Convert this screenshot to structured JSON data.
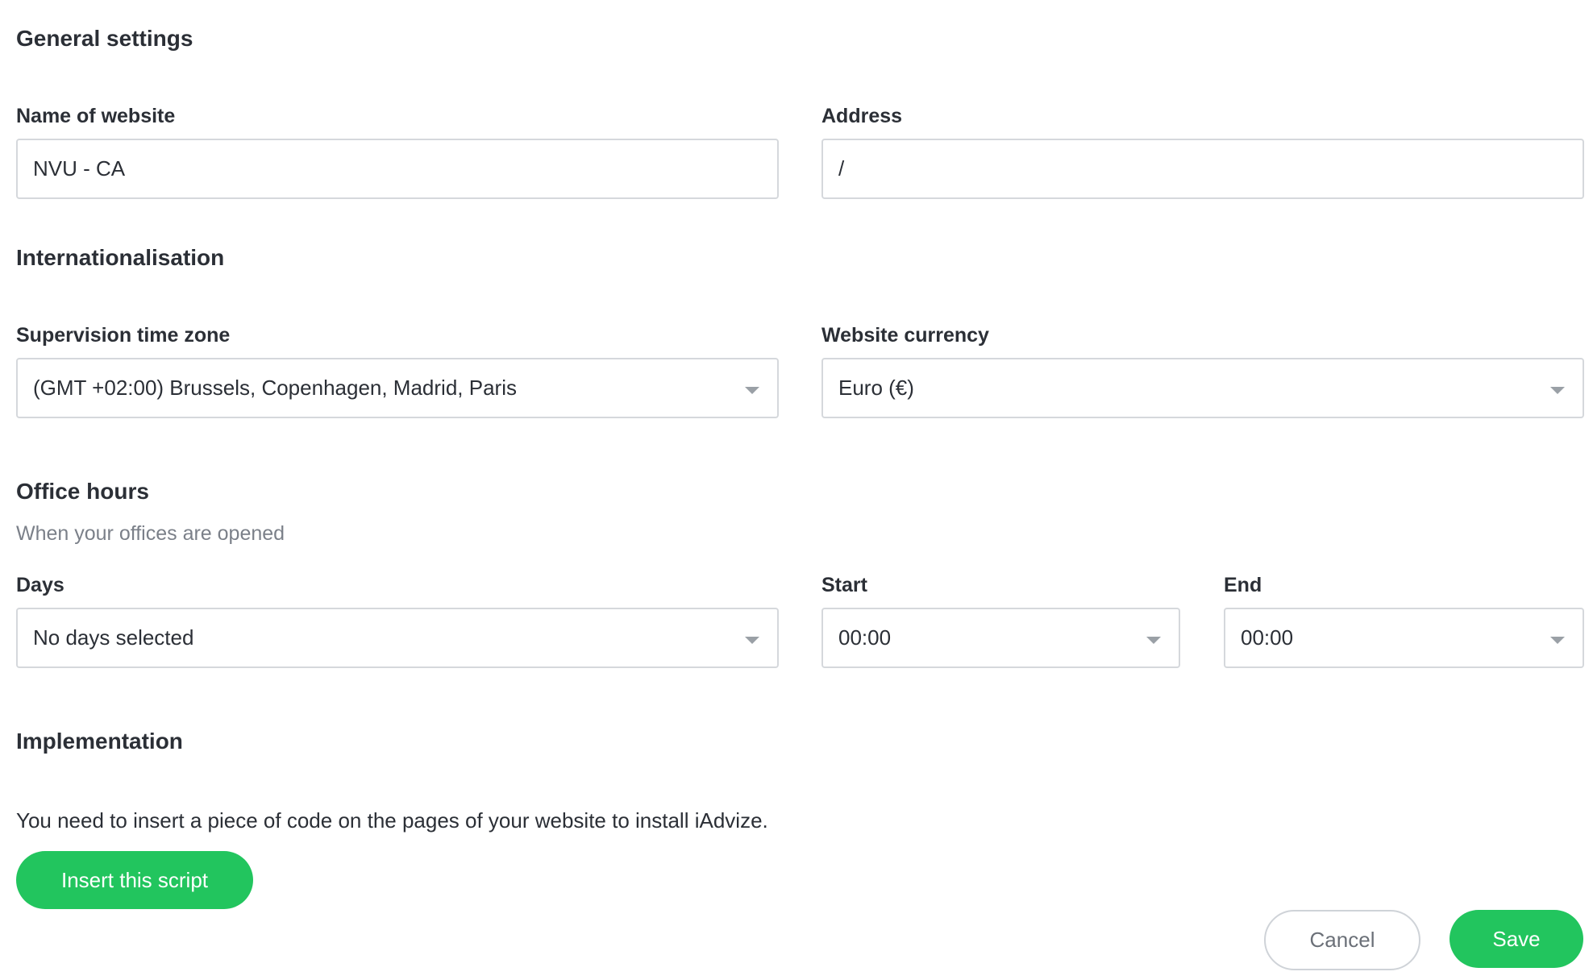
{
  "general": {
    "title": "General settings",
    "name_label": "Name of website",
    "name_value": "NVU - CA",
    "address_label": "Address",
    "address_value": "/"
  },
  "internationalisation": {
    "title": "Internationalisation",
    "timezone_label": "Supervision time zone",
    "timezone_value": "(GMT +02:00) Brussels, Copenhagen, Madrid, Paris",
    "currency_label": "Website currency",
    "currency_value": "Euro (€)"
  },
  "office_hours": {
    "title": "Office hours",
    "subtitle": "When your offices are opened",
    "days_label": "Days",
    "days_value": "No days selected",
    "start_label": "Start",
    "start_value": "00:00",
    "end_label": "End",
    "end_value": "00:00"
  },
  "implementation": {
    "title": "Implementation",
    "description": "You need to insert a piece of code on the pages of your website to install iAdvize.",
    "insert_button": "Insert this script"
  },
  "footer": {
    "cancel_label": "Cancel",
    "save_label": "Save"
  },
  "colors": {
    "accent": "#22c55e",
    "text": "#2b2f36",
    "muted": "#7b8089",
    "border": "#d5d8dc"
  },
  "icons": {
    "dropdown": "chevron-down-icon"
  }
}
